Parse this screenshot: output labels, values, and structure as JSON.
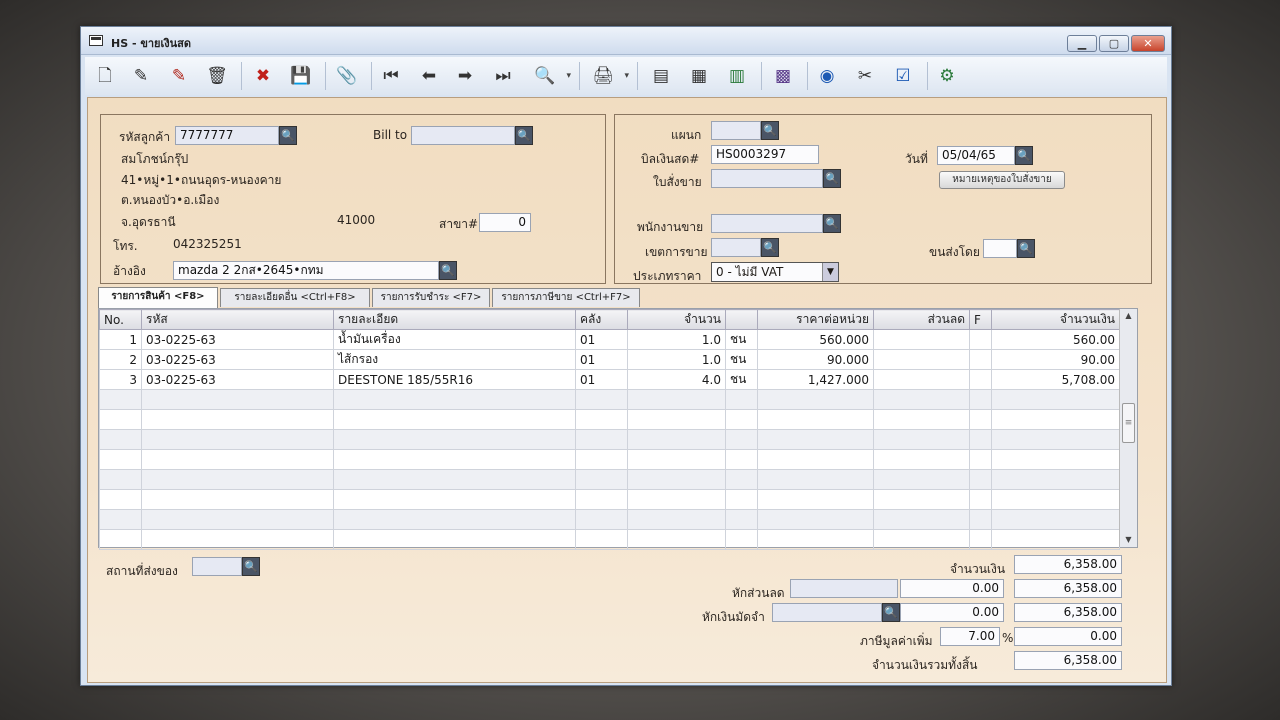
{
  "window": {
    "title": "HS - ขายเงินสด",
    "minimize": "▁",
    "maximize": "▢",
    "close": "✕"
  },
  "toolbar": [
    {
      "name": "new-icon",
      "glyph": "🗋"
    },
    {
      "name": "edit-icon",
      "glyph": "✎"
    },
    {
      "name": "edit-red-icon",
      "glyph": "✎"
    },
    {
      "name": "trash-icon",
      "glyph": "🗑"
    },
    {
      "name": "cancel-icon",
      "glyph": "✖"
    },
    {
      "name": "save-icon",
      "glyph": "💾"
    },
    {
      "name": "attach-icon",
      "glyph": "📎"
    },
    {
      "name": "first-record-icon",
      "glyph": "⏮"
    },
    {
      "name": "prev-record-icon",
      "glyph": "⬅"
    },
    {
      "name": "next-record-icon",
      "glyph": "➡"
    },
    {
      "name": "last-record-icon",
      "glyph": "⏭"
    },
    {
      "name": "find-icon",
      "glyph": "🔍"
    },
    {
      "name": "print-icon",
      "glyph": "🖨"
    },
    {
      "name": "report-icon",
      "glyph": "▤"
    },
    {
      "name": "form-icon",
      "glyph": "▦"
    },
    {
      "name": "chart-icon",
      "glyph": "▥"
    },
    {
      "name": "calendar-icon",
      "glyph": "▩"
    },
    {
      "name": "disk-ok-icon",
      "glyph": "◉"
    },
    {
      "name": "scissors-ok-icon",
      "glyph": "✂"
    },
    {
      "name": "ok-icon",
      "glyph": "☑"
    },
    {
      "name": "settings-icon",
      "glyph": "⚙"
    }
  ],
  "customer": {
    "code_label": "รหัสลูกค้า",
    "code": "7777777",
    "billto_label": "Bill to",
    "name": "สมโภชน์กรุ๊ป",
    "addr1": "41•หมู่•1•ถนนอุดร-หนองคาย",
    "addr2": "ต.หนองบัว•อ.เมือง",
    "province": "จ.อุดรธานี",
    "postcode": "41000",
    "branch_label": "สาขา#",
    "branch": "0",
    "phone_label": "โทร.",
    "phone": "042325251",
    "ref_label": "อ้างอิง",
    "ref": "mazda 2 2กส•2645•กทม"
  },
  "doc": {
    "dept_label": "แผนก",
    "bill_label": "บิลเงินสด#",
    "bill_no": "HS0003297",
    "order_label": "ใบสั่งขาย",
    "date_label": "วันที่",
    "date": "05/04/65",
    "note_button": "หมายเหตุของใบสั่งขาย",
    "sales_label": "พนักงานขาย",
    "zone_label": "เขตการขาย",
    "ship_label": "ขนส่งโดย",
    "price_type_label": "ประเภทราคา",
    "price_type": "0 - ไม่มี VAT"
  },
  "tabs": [
    "รายการสินค้า <F8>",
    "รายละเอียดอื่น <Ctrl+F8>",
    "รายการรับชำระ <F7>",
    "รายการภาษีขาย <Ctrl+F7>"
  ],
  "grid": {
    "columns": [
      "No.",
      "รหัส",
      "รายละเอียด",
      "คลัง",
      "จำนวน",
      "",
      "ราคาต่อหน่วย",
      "ส่วนลด",
      "F",
      "จำนวนเงิน"
    ],
    "rows": [
      {
        "no": "1",
        "code": "03-0225-63",
        "desc": "น้ำมันเครื่อง",
        "wh": "01",
        "qty": "1.0",
        "unit": "ชน",
        "price": "560.000",
        "disc": "",
        "f": "",
        "amount": "560.00"
      },
      {
        "no": "2",
        "code": "03-0225-63",
        "desc": "ไส้กรอง",
        "wh": "01",
        "qty": "1.0",
        "unit": "ชน",
        "price": "90.000",
        "disc": "",
        "f": "",
        "amount": "90.00"
      },
      {
        "no": "3",
        "code": "03-0225-63",
        "desc": "DEESTONE 185/55R16",
        "wh": "01",
        "qty": "4.0",
        "unit": "ชน",
        "price": "1,427.000",
        "disc": "",
        "f": "",
        "amount": "5,708.00"
      }
    ],
    "empty_rows": 8
  },
  "footer": {
    "delivery_label": "สถานที่ส่งของ",
    "amount_label": "จำนวนเงิน",
    "amount": "6,358.00",
    "discount_label": "หักส่วนลด",
    "discount": "0.00",
    "after_discount": "6,358.00",
    "deposit_label": "หักเงินมัดจำ",
    "deposit": "0.00",
    "after_deposit": "6,358.00",
    "vat_label": "ภาษีมูลค่าเพิ่ม",
    "vat_rate": "7.00",
    "vat_pct": "%",
    "vat_amount": "0.00",
    "total_label": "จำนวนเงินรวมทั้งสิ้น",
    "total": "6,358.00"
  }
}
